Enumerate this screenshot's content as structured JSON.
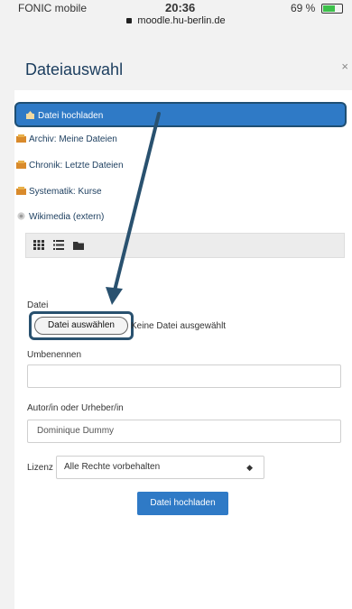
{
  "status": {
    "carrier": "FONIC mobile",
    "time": "20:36",
    "battery": "69 %"
  },
  "browser": {
    "url": "moodle.hu-berlin.de"
  },
  "dialog": {
    "title": "Dateiauswahl",
    "close": "×",
    "repositories": [
      {
        "label": "Datei hochladen",
        "icon": "upload-icon",
        "active": true
      },
      {
        "label": "Archiv: Meine Dateien",
        "icon": "user-files-icon"
      },
      {
        "label": "Chronik: Letzte Dateien",
        "icon": "recent-icon"
      },
      {
        "label": "Systematik: Kurse",
        "icon": "course-icon"
      },
      {
        "label": "Wikimedia (extern)",
        "icon": "wikimedia-icon"
      }
    ],
    "view_icons": [
      "grid-view-icon",
      "list-view-icon",
      "folder-view-icon"
    ]
  },
  "form": {
    "file_label": "Datei",
    "file_button": "Datei auswählen",
    "no_file": "Keine Datei ausgewählt",
    "rename_label": "Umbenennen",
    "rename_value": "",
    "author_label": "Autor/in oder Urheber/in",
    "author_value": "Dominique Dummy",
    "license_label": "Lizenz",
    "license_value": "Alle Rechte vorbehalten",
    "submit_label": "Datei hochladen"
  },
  "colors": {
    "accent": "#2f7ac6",
    "annotation": "#29516f",
    "title": "#1b3d5e"
  }
}
